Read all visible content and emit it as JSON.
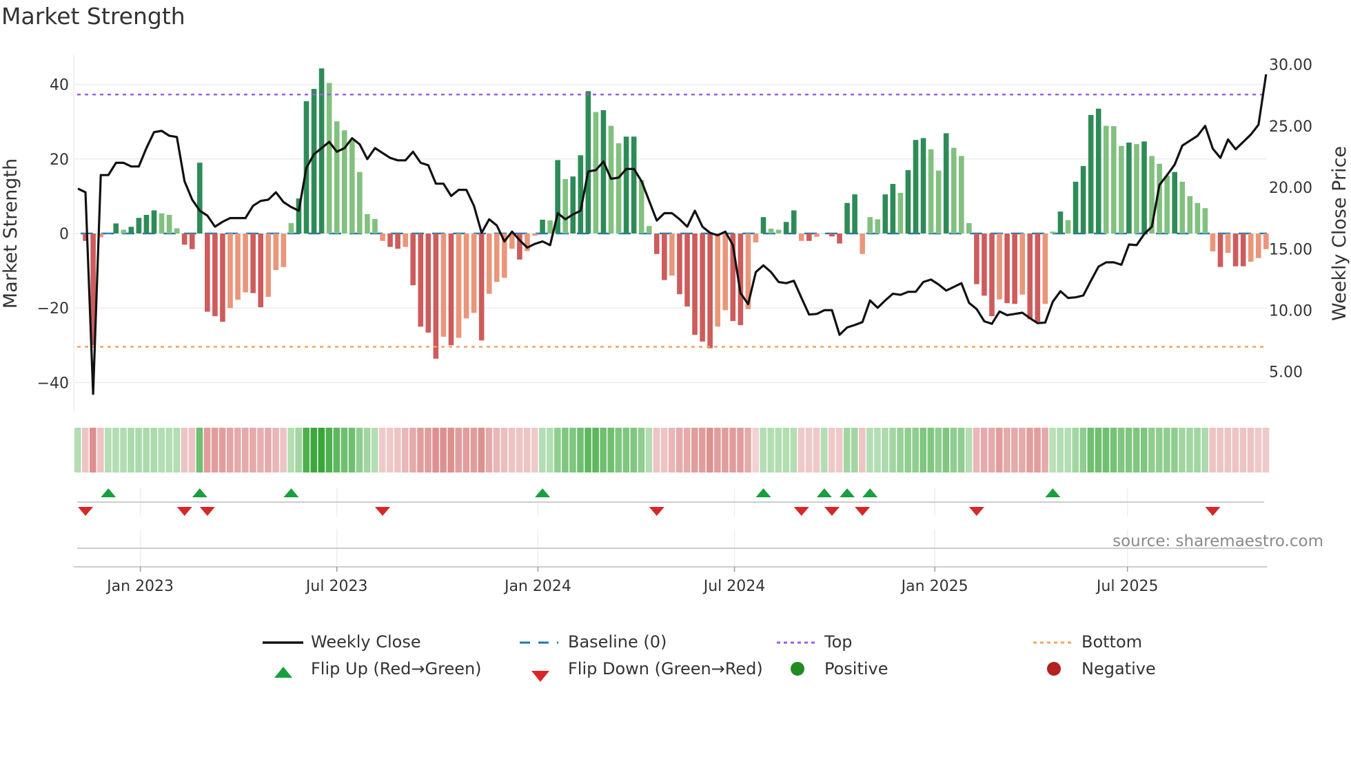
{
  "chart_data": {
    "type": "bar",
    "title": "Market Strength",
    "ylabel": "Market Strength",
    "y2label": "Weekly Close Price",
    "ylim": [
      -48,
      48
    ],
    "yticks": [
      40,
      20,
      0,
      -20,
      -40
    ],
    "ytick_labels": [
      "40",
      "20",
      "0",
      "−20",
      "−40"
    ],
    "y2ticks": [
      30,
      25,
      20,
      15,
      10,
      5
    ],
    "y2tick_labels": [
      "30.00",
      "25.00",
      "20.00",
      "15.00",
      "10.00",
      "5.00"
    ],
    "xticks": [
      {
        "week": 8.2,
        "label": "Jan 2023"
      },
      {
        "week": 34.0,
        "label": "Jul 2023"
      },
      {
        "week": 60.4,
        "label": "Jan 2024"
      },
      {
        "week": 86.2,
        "label": "Jul 2024"
      },
      {
        "week": 112.5,
        "label": "Jan 2025"
      },
      {
        "week": 137.8,
        "label": "Jul 2025"
      }
    ],
    "top": 37.3,
    "bottom": -30.4,
    "baseline": 0,
    "strength": [
      -2,
      -30,
      -1,
      0,
      2.7,
      1,
      1.8,
      4.2,
      5,
      6.2,
      5.4,
      5,
      1.4,
      -3,
      -4.2,
      19,
      -21,
      -22.2,
      -23.7,
      -20,
      -17.8,
      -15.8,
      -16,
      -19.8,
      -17,
      -9.8,
      -9,
      2.8,
      9.4,
      35.5,
      38.8,
      44.3,
      40.4,
      30.1,
      27.7,
      25,
      16.5,
      5.2,
      3.9,
      -2,
      -3.6,
      -4.1,
      -3.6,
      -13.9,
      -25,
      -26.6,
      -33.6,
      -27.7,
      -30,
      -28,
      -22.8,
      -21.3,
      -28.7,
      -16.2,
      -13,
      -11.9,
      -4.1,
      -7,
      -4.7,
      -0.6,
      3.7,
      3.5,
      19.7,
      14.6,
      15.3,
      21,
      38.2,
      32.6,
      33.1,
      28.9,
      24.2,
      26,
      26,
      14.3,
      2,
      -5.5,
      -12.5,
      -11.3,
      -16.3,
      -19.6,
      -27.2,
      -29,
      -30.8,
      -25,
      -20.6,
      -23.5,
      -24.6,
      -20.3,
      -2.4,
      4.4,
      1.3,
      1,
      3.1,
      6.2,
      -2,
      -2,
      -0.9,
      0,
      -0.8,
      -2.7,
      8.2,
      10.5,
      -5.5,
      4.4,
      3.8,
      10.5,
      13.3,
      10.9,
      17,
      25.1,
      25.6,
      22.6,
      16.9,
      26.9,
      23,
      20.8,
      2.8,
      -13.6,
      -16.7,
      -22.2,
      -17.7,
      -18.7,
      -18.9,
      -16.4,
      -23,
      -23.7,
      -18.9,
      0.5,
      5.9,
      3.6,
      13.9,
      18.1,
      31.8,
      33.5,
      28.9,
      28.8,
      23.5,
      24.4,
      24,
      24.7,
      20.8,
      18.7,
      15.5,
      16.5,
      13.9,
      10,
      8.2,
      6.8,
      -4.8,
      -9,
      -5.2,
      -8.8,
      -8.8,
      -7.6,
      -6.6,
      -4.2
    ],
    "weekly_close": [
      19.9,
      19.6,
      3.2,
      21.0,
      21.0,
      22.0,
      22.0,
      21.7,
      21.7,
      23.2,
      24.5,
      24.6,
      24.2,
      24.1,
      20.5,
      19.0,
      18.1,
      17.7,
      16.8,
      17.2,
      17.5,
      17.5,
      17.5,
      18.5,
      18.9,
      19.0,
      19.6,
      18.8,
      18.4,
      18.1,
      21.6,
      22.7,
      23.2,
      23.7,
      22.9,
      23.2,
      24.0,
      23.5,
      22.3,
      23.2,
      22.8,
      22.4,
      22.2,
      22.2,
      22.9,
      22.0,
      21.8,
      20.3,
      20.3,
      19.3,
      19.8,
      19.8,
      18.5,
      16.3,
      17.4,
      16.9,
      15.6,
      16.4,
      15.7,
      15.1,
      15.4,
      15.6,
      15.3,
      17.9,
      17.4,
      17.8,
      18.1,
      21.3,
      21.4,
      22.1,
      20.7,
      20.8,
      21.5,
      21.5,
      20.5,
      18.9,
      17.3,
      17.9,
      17.9,
      17.4,
      16.8,
      18.1,
      16.8,
      16.3,
      16.1,
      16.4,
      15.3,
      11.4,
      10.5,
      13.1,
      13.65,
      13.1,
      12.3,
      12.2,
      12.4,
      11.0,
      9.65,
      9.7,
      10.0,
      10.0,
      8.0,
      8.6,
      8.8,
      9.04,
      10.8,
      10.2,
      10.8,
      11.35,
      11.25,
      11.5,
      11.5,
      12.3,
      12.5,
      12.1,
      11.6,
      11.9,
      12.2,
      10.6,
      10.1,
      9.1,
      8.9,
      9.9,
      9.6,
      9.7,
      9.8,
      9.35,
      8.95,
      9.0,
      10.7,
      11.55,
      11.0,
      11.05,
      11.2,
      12.4,
      13.55,
      13.9,
      13.9,
      13.7,
      15.35,
      15.3,
      16.2,
      16.8,
      20.2,
      21.0,
      21.85,
      23.4,
      23.8,
      24.2,
      25.0,
      23.15,
      22.4,
      23.9,
      23.1,
      23.7,
      24.3,
      25.1,
      29.2
    ],
    "regime_strip": [
      1,
      -1,
      -3,
      -1,
      1,
      1,
      1,
      1.2,
      1.2,
      1.2,
      1.2,
      1,
      1,
      1,
      -1,
      -1,
      3,
      -2.5,
      -2.5,
      -2.5,
      -2.2,
      -2,
      -2,
      -2,
      -1.8,
      -2,
      -1.5,
      -1,
      1,
      1.5,
      4,
      4.5,
      5,
      4,
      3.5,
      3,
      3,
      2,
      1.5,
      1,
      -0.8,
      -0.8,
      -1,
      -1.5,
      -2,
      -2.5,
      -2.5,
      -3,
      -3,
      -3,
      -2.5,
      -2.5,
      -2.5,
      -3,
      -2,
      -1.5,
      -1.2,
      -1,
      -1,
      -1,
      -0.8,
      1,
      1,
      2,
      2.5,
      2.5,
      3,
      3.5,
      3.5,
      3,
      3,
      2.5,
      2.5,
      2.5,
      2,
      1,
      -1,
      -1,
      -1.5,
      -2,
      -2,
      -2.5,
      -2.5,
      -3,
      -2.5,
      -2.5,
      -2.5,
      -2.5,
      -2,
      -0.5,
      1,
      1,
      1,
      1,
      1,
      -0.8,
      -0.8,
      -0.8,
      1,
      -0.8,
      -0.8,
      1.5,
      1.5,
      -1,
      1,
      1,
      1.2,
      1.5,
      1.8,
      2,
      2,
      2.5,
      2.5,
      2,
      2.5,
      2,
      2,
      1,
      -1.5,
      -2,
      -2,
      -2.5,
      -2,
      -2,
      -2,
      -2.5,
      -2.5,
      -2,
      0.8,
      1,
      1,
      1.5,
      2,
      3,
      3,
      3,
      2.8,
      2.5,
      2.5,
      2.5,
      2.5,
      2,
      2,
      2,
      2,
      1.5,
      1.5,
      1.5,
      1.2,
      -1,
      -1,
      -1,
      -1,
      -1,
      -1,
      -0.8,
      -0.8
    ],
    "flip_up_weeks": [
      5,
      17,
      29,
      62,
      91,
      99,
      102,
      105,
      129
    ],
    "flip_down_weeks": [
      2,
      15,
      18,
      41,
      77,
      96,
      100,
      104,
      119,
      150
    ],
    "legend": {
      "weekly_close": "Weekly Close",
      "baseline": "Baseline (0)",
      "top": "Top",
      "bottom": "Bottom",
      "flip_up": "Flip Up (Red→Green)",
      "flip_down": "Flip Down (Green→Red)",
      "positive": "Positive",
      "negative": "Negative"
    },
    "source": "source: sharemaestro.com"
  },
  "colors": {
    "strong_up": "#2e8b57",
    "weak_up": "#82c07f",
    "strong_down": "#cd5c5c",
    "weak_down": "#e9967a",
    "top": "#9b5fe0",
    "bottom": "#f4a460",
    "baseline": "#1f77b4",
    "flip_up": "#1a9e3f",
    "flip_down": "#d62728",
    "positive": "#228b22",
    "negative": "#b22222",
    "strip_green": "44,160,44",
    "strip_red": "205,92,92"
  }
}
